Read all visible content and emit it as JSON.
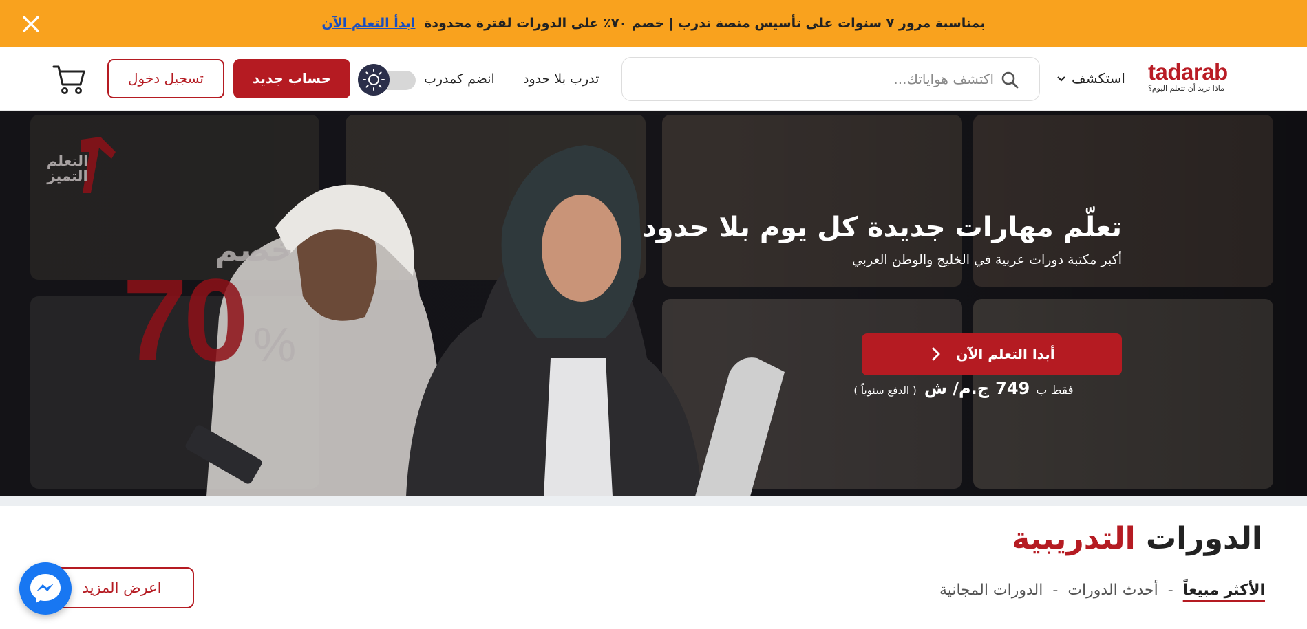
{
  "promo": {
    "text": "بمناسبة مرور ٧ سنوات على تأسيس منصة تدرب | خصم ٧٠٪ على الدورات لفترة محدودة",
    "link": "ابدأ التعلم الآن"
  },
  "header": {
    "logo_word": "tadarab",
    "logo_tagline": "ماذا تريد أن تتعلم اليوم؟",
    "explore": "استكشف",
    "search_placeholder": "اكتشف هواياتك...",
    "nav_unlimited": "تدرب بلا حدود",
    "nav_instructor": "انضم كمدرب",
    "signup": "حساب جديد",
    "login": "تسجيل دخول"
  },
  "hero": {
    "title": "تعلّم مهارات جديدة كل يوم بلا حدود",
    "subtitle": "أكبر مكتبة دورات عربية في الخليج والوطن العربي",
    "cta": "أبدا التعلم الآن",
    "price_prefix": "فقط ب",
    "price_amount": "749",
    "price_currency": "ج.م/ ش",
    "price_note": "( الدفع سنوياً )",
    "discount_word": "خصم",
    "discount_number": "70",
    "discount_percent": "%",
    "badge_text": "التعلم التميز",
    "badge_number": "٧"
  },
  "courses": {
    "title_main": "الدورات",
    "title_accent": "التدريبية",
    "tabs": [
      "الأكثر مبيعاً",
      "أحدث الدورات",
      "الدورات المجانية"
    ],
    "separator": "-",
    "more": "اعرض المزيد"
  },
  "colors": {
    "promo_bg": "#f9a21e",
    "brand_red": "#b51b22",
    "link_blue": "#1a4fbf",
    "messenger_blue": "#1877f2"
  },
  "icons": [
    "close-icon",
    "chevron-down-icon",
    "search-icon",
    "sun-icon",
    "cart-icon",
    "chevron-right-icon",
    "messenger-icon"
  ]
}
